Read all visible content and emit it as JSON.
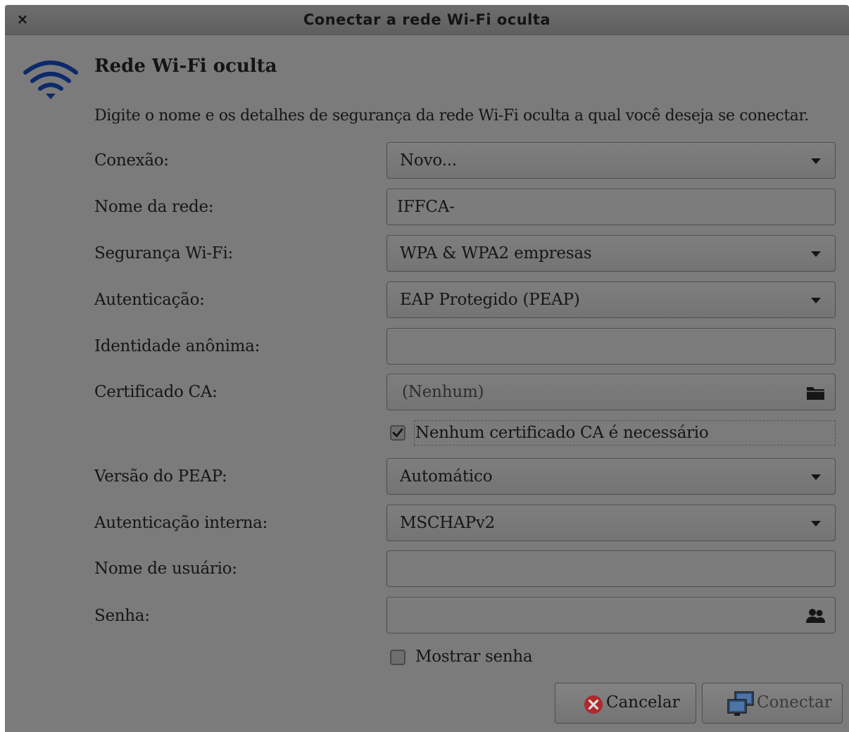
{
  "window": {
    "title": "Conectar a rede Wi-Fi oculta",
    "close_label": "×"
  },
  "header": {
    "title": "Rede Wi-Fi oculta",
    "description": "Digite o nome e os detalhes de segurança da rede Wi-Fi oculta a qual você deseja se conectar.",
    "icon": "wifi-icon"
  },
  "form": {
    "connection": {
      "label": "Conexão:",
      "value": "Novo..."
    },
    "network_name": {
      "label": "Nome da rede:",
      "value": "IFFCA-"
    },
    "wifi_security": {
      "label": "Segurança Wi-Fi:",
      "value": "WPA & WPA2 empresas"
    },
    "authentication": {
      "label": "Autenticação:",
      "value": "EAP Protegido (PEAP)"
    },
    "anonymous_identity": {
      "label": "Identidade anônima:",
      "value": ""
    },
    "ca_certificate": {
      "label": "Certificado CA:",
      "value": "(Nenhum)",
      "icon": "folder-icon"
    },
    "no_ca_required": {
      "label": "Nenhum certificado CA é necessário",
      "checked": true
    },
    "peap_version": {
      "label": "Versão do PEAP:",
      "value": "Automático"
    },
    "inner_authentication": {
      "label": "Autenticação interna:",
      "value": "MSCHAPv2"
    },
    "username": {
      "label": "Nome de usuário:",
      "value": ""
    },
    "password": {
      "label": "Senha:",
      "value": "",
      "icon": "users-icon"
    },
    "show_password": {
      "label": "Mostrar senha",
      "checked": false
    }
  },
  "buttons": {
    "cancel": "Cancelar",
    "connect": "Conectar"
  },
  "colors": {
    "wifi_icon": "#0c2a6b",
    "cancel_icon": "#b0282a",
    "connect_icon": "#2d4f7a"
  }
}
